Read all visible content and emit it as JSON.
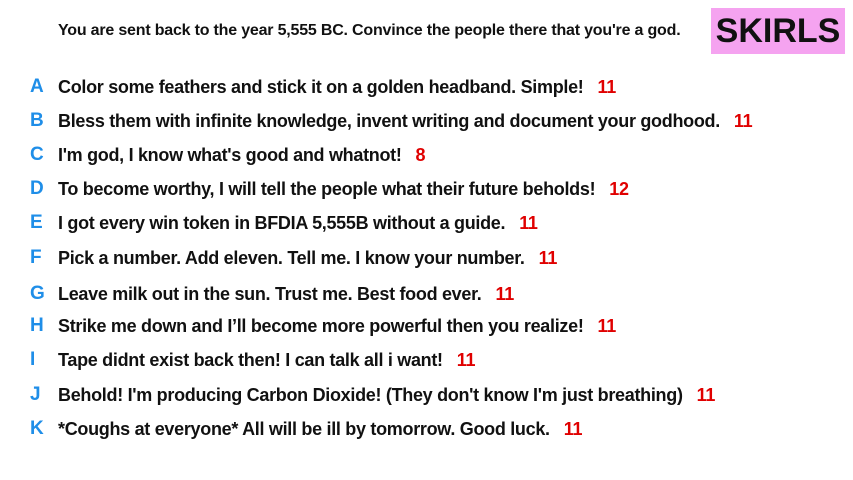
{
  "prompt": "You are sent back to the year 5,555 BC. Convince the people there that you're a god.",
  "logo": "SKIRLS",
  "colors": {
    "letter": "#1f8ee8",
    "score": "#e00000",
    "logo_bg": "#f5a3f0"
  },
  "options": [
    {
      "letter": "A",
      "text": "Color some feathers and stick it on a golden headband. Simple!",
      "score": "11"
    },
    {
      "letter": "B",
      "text": "Bless them with infinite knowledge, invent writing and document your godhood.",
      "score": "11"
    },
    {
      "letter": "C",
      "text": "I'm god, I know what's good and whatnot!",
      "score": "8"
    },
    {
      "letter": "D",
      "text": "To become worthy, I will tell the people what their future beholds!",
      "score": "12"
    },
    {
      "letter": "E",
      "text": "I got every win token in BFDIA 5,555B without a guide.",
      "score": "11"
    },
    {
      "letter": "F",
      "text": "Pick a number. Add eleven. Tell me. I know your number.",
      "score": "11"
    },
    {
      "letter": "G",
      "text": "Leave milk out in the sun. Trust me. Best food ever.",
      "score": "11"
    },
    {
      "letter": "H",
      "text": "Strike me down and I’ll become more powerful then you realize!",
      "score": "11"
    },
    {
      "letter": "I",
      "text": "Tape didnt exist back then! I can talk all i want!",
      "score": "11"
    },
    {
      "letter": "J",
      "text": "Behold! I'm producing Carbon Dioxide! (They don't know I'm just breathing)",
      "score": "11"
    },
    {
      "letter": "K",
      "text": "*Coughs at everyone* All will be ill by tomorrow. Good luck.",
      "score": "11"
    }
  ]
}
